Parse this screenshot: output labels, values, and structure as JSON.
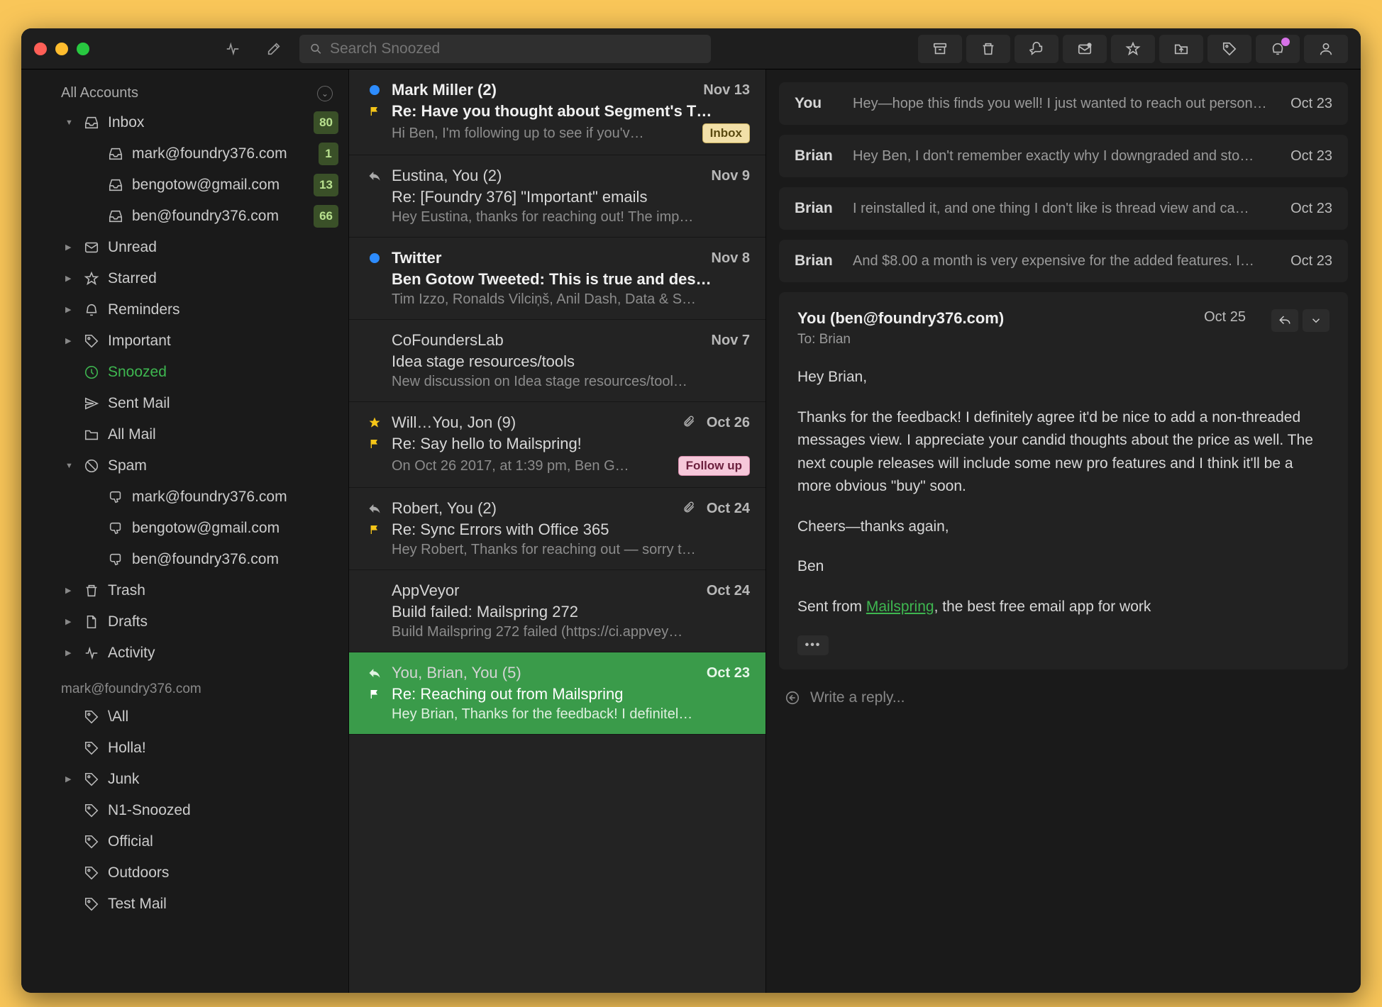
{
  "search": {
    "placeholder": "Search Snoozed"
  },
  "sidebar": {
    "header": "All Accounts",
    "items": [
      {
        "tri": "open",
        "icon": "inbox",
        "label": "Inbox",
        "badge": "80"
      },
      {
        "indent": 2,
        "icon": "inbox",
        "label": "mark@foundry376.com",
        "badge": "1"
      },
      {
        "indent": 2,
        "icon": "inbox",
        "label": "bengotow@gmail.com",
        "badge": "13"
      },
      {
        "indent": 2,
        "icon": "inbox",
        "label": "ben@foundry376.com",
        "badge": "66"
      },
      {
        "tri": "closed",
        "icon": "mail",
        "label": "Unread"
      },
      {
        "tri": "closed",
        "icon": "star",
        "label": "Starred"
      },
      {
        "tri": "closed",
        "icon": "bell",
        "label": "Reminders"
      },
      {
        "tri": "closed",
        "icon": "tag",
        "label": "Important"
      },
      {
        "active": true,
        "icon": "clock",
        "label": "Snoozed"
      },
      {
        "icon": "send",
        "label": "Sent Mail"
      },
      {
        "icon": "folder",
        "label": "All Mail"
      },
      {
        "tri": "open",
        "icon": "spam",
        "label": "Spam"
      },
      {
        "indent": 2,
        "icon": "thumbdown",
        "label": "mark@foundry376.com"
      },
      {
        "indent": 2,
        "icon": "thumbdown",
        "label": "bengotow@gmail.com"
      },
      {
        "indent": 2,
        "icon": "thumbdown",
        "label": "ben@foundry376.com"
      },
      {
        "tri": "closed",
        "icon": "trash",
        "label": "Trash"
      },
      {
        "tri": "closed",
        "icon": "file",
        "label": "Drafts"
      },
      {
        "tri": "closed",
        "icon": "activity",
        "label": "Activity"
      }
    ],
    "section_label": "mark@foundry376.com",
    "labels": [
      {
        "label": "\\All"
      },
      {
        "label": "Holla!"
      },
      {
        "tri": "closed",
        "label": "Junk"
      },
      {
        "label": "N1-Snoozed"
      },
      {
        "label": "Official"
      },
      {
        "label": "Outdoors"
      },
      {
        "label": "Test Mail"
      }
    ]
  },
  "threads": [
    {
      "lead": "bluedot",
      "from": "Mark Miller (2)",
      "bold": true,
      "date": "Nov 13",
      "flag": "yellow",
      "subject": "Re: Have you thought about Segment's T…",
      "preview": "Hi Ben, I'm following up to see if you'v…",
      "chip": "Inbox",
      "chip_kind": "inbox"
    },
    {
      "lead": "reply",
      "from": "Eustina, You (2)",
      "date": "Nov 9",
      "subject": "Re: [Foundry 376] \"Important\" emails",
      "preview": "Hey Eustina, thanks for reaching out! The imp…"
    },
    {
      "lead": "bluedot",
      "from": "Twitter",
      "bold": true,
      "date": "Nov 8",
      "subject": "Ben Gotow Tweeted: This is true and des…",
      "preview": "Tim Izzo, Ronalds Vilciņš, Anil Dash, Data & S…"
    },
    {
      "from": "CoFoundersLab",
      "date": "Nov 7",
      "subject": "Idea stage resources/tools",
      "preview": "New discussion on Idea stage resources/tool…"
    },
    {
      "lead": "star",
      "from": "Will…You, Jon (9)",
      "date": "Oct 26",
      "attach": true,
      "flag": "yellow",
      "subject": "Re: Say hello to Mailspring!",
      "preview": "On Oct 26 2017, at 1:39 pm, Ben G…",
      "chip": "Follow up",
      "chip_kind": "follow"
    },
    {
      "lead": "reply",
      "from": "Robert, You (2)",
      "date": "Oct 24",
      "attach": true,
      "flag": "yellow",
      "subject": "Re: Sync Errors with Office 365",
      "preview": "Hey Robert, Thanks for reaching out — sorry t…"
    },
    {
      "from": "AppVeyor",
      "date": "Oct 24",
      "subject": "Build failed: Mailspring 272",
      "preview": "Build Mailspring 272 failed (https://ci.appvey…"
    },
    {
      "selected": true,
      "lead": "reply",
      "from": "You, Brian, You (5)",
      "date": "Oct 23",
      "flag": "white",
      "subject": "Re: Reaching out from Mailspring",
      "preview": "Hey Brian, Thanks for the feedback! I definitel…"
    }
  ],
  "reader": {
    "collapsed": [
      {
        "from": "You",
        "preview": "Hey—hope this finds you well! I just wanted to reach out person…",
        "date": "Oct 23"
      },
      {
        "from": "Brian",
        "preview": "Hey Ben, I don't remember exactly why I downgraded and sto…",
        "date": "Oct 23"
      },
      {
        "from": "Brian",
        "preview": "I reinstalled it, and one thing I don't like is thread view and ca…",
        "date": "Oct 23"
      },
      {
        "from": "Brian",
        "preview": "And $8.00 a month is very expensive for the added features. I…",
        "date": "Oct 23"
      }
    ],
    "open": {
      "from": "You (ben@foundry376.com)",
      "to": "To: Brian",
      "date": "Oct 25",
      "body_p1": "Hey Brian,",
      "body_p2": "Thanks for the feedback! I definitely agree it'd be nice to add a non-threaded messages view. I appreciate your candid thoughts about the price as well. The next couple releases will include some new pro features and I think it'll be a more obvious \"buy\" soon.",
      "body_p3": "Cheers—thanks again,",
      "body_p4": "Ben",
      "sig_pre": "Sent from ",
      "sig_link": "Mailspring",
      "sig_post": ", the best free email app for work"
    },
    "reply_placeholder": "Write a reply..."
  }
}
